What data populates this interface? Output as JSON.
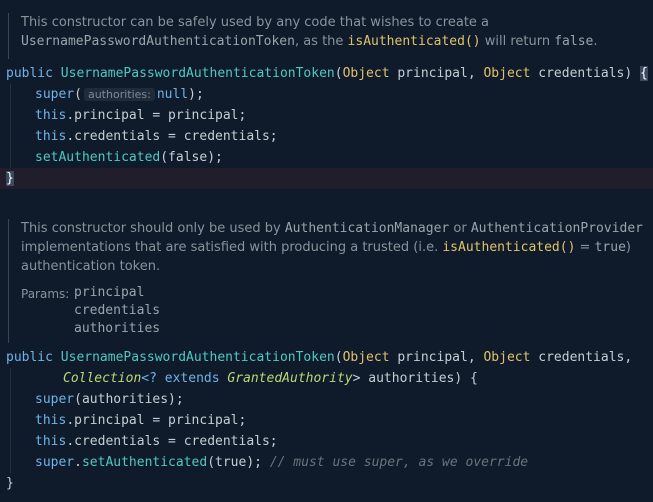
{
  "doc1": {
    "line1": "This constructor can be safely used by any code that wishes to create a",
    "class_ref": "UsernamePasswordAuthenticationToken",
    "as_the": ", as the ",
    "method_ref": "isAuthenticated()",
    "will_return": " will return ",
    "false_lit": "false",
    "period": "."
  },
  "code1": {
    "public": "public ",
    "ctor": "UsernamePasswordAuthenticationToken",
    "open": "(",
    "type_obj": "Object",
    "principal": " principal",
    "comma": ", ",
    "type_obj2": "Object",
    "credentials": " credentials",
    "close": ") ",
    "brace_open": "{",
    "super_kw": "super",
    "super_open": "(",
    "hint_label": "authorities:",
    "null_arg": "null",
    "super_close": ");",
    "this1": "this",
    "principal_assign": ".principal = principal;",
    "this2": "this",
    "credentials_assign": ".credentials = credentials;",
    "set_auth": "setAuthenticated",
    "set_auth_args": "(false);",
    "brace_close": "}"
  },
  "doc2": {
    "part1": "This constructor should only be used by ",
    "manager_ref": "AuthenticationManager",
    "or": " or ",
    "provider_ref": "AuthenticationProvider",
    "part2": "implementations that are satisfied with producing a trusted (i.e. ",
    "method_ref": "isAuthenticated()",
    "eq": " = ",
    "true_lit": "true",
    "part2_end": ")",
    "part3": "authentication token.",
    "params_label": "Params:",
    "params": [
      "principal",
      "credentials",
      "authorities"
    ]
  },
  "code2": {
    "public": "public ",
    "ctor": "UsernamePasswordAuthenticationToken",
    "open": "(",
    "type_obj": "Object",
    "principal": " principal",
    "comma": ", ",
    "type_obj2": "Object",
    "credentials": " credentials,",
    "collection": "Collection",
    "generic_open": "<? extends ",
    "granted": "GrantedAuthority",
    "generic_close": "> authorities) {",
    "super_kw": "super",
    "super_args": "(authorities);",
    "this1": "this",
    "principal_assign": ".principal = principal;",
    "this2": "this",
    "credentials_assign": ".credentials = credentials;",
    "super_kw2": "super",
    "dot": ".",
    "set_auth": "setAuthenticated",
    "set_auth_args": "(true); ",
    "comment": "// must use super, as we override",
    "brace_close": "}"
  },
  "colors": {
    "background": "#0f1b2a",
    "keyword": "#6fb3e6",
    "function": "#4ec9c0",
    "type": "#e0c26b",
    "comment": "#6a737d"
  }
}
